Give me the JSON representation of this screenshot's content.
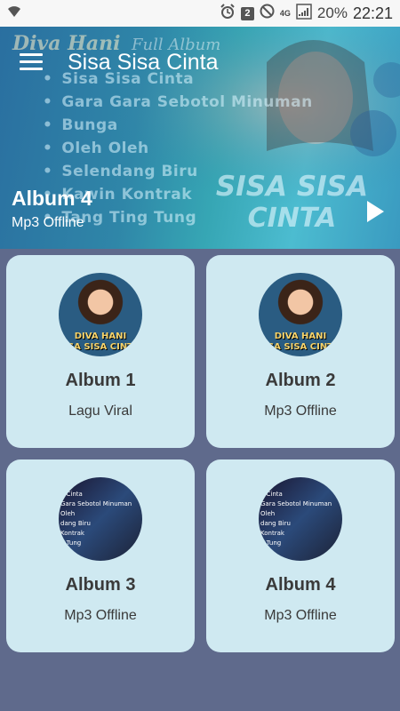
{
  "status_bar": {
    "badge": "2",
    "network": "4G",
    "battery": "20%",
    "time": "22:21"
  },
  "header": {
    "app_title": "Sisa Sisa Cinta",
    "current_album": "Album 4",
    "current_subtitle": "Mp3 Offline",
    "banner": {
      "artist": "Diva Hani",
      "full_album": "Full Album",
      "tracks": [
        "Sisa Sisa Cinta",
        "Gara Gara Sebotol Minuman",
        "Bunga",
        "Oleh Oleh",
        "Selendang Biru",
        "Kawin Kontrak",
        "Tang Ting Tung"
      ],
      "title_line1": "SISA SISA",
      "title_line2": "CINTA"
    }
  },
  "albums": [
    {
      "title": "Album 1",
      "subtitle": "Lagu Viral",
      "thumb_top": "DIVA HANI",
      "thumb_bottom": "SA SISA CINT"
    },
    {
      "title": "Album 2",
      "subtitle": "Mp3 Offline",
      "thumb_top": "DIVA HANI",
      "thumb_bottom": "SA SISA CINT"
    },
    {
      "title": "Album 3",
      "subtitle": "Mp3 Offline",
      "thumb_lines": [
        "a Cinta",
        "Gara Sebotol Minuman",
        "Oleh",
        "dang Biru",
        "Kontrak",
        "g Tung"
      ]
    },
    {
      "title": "Album 4",
      "subtitle": "Mp3 Offline",
      "thumb_lines": [
        "a Cinta",
        "Gara Sebotol Minuman",
        "Oleh",
        "dang Biru",
        "Kontrak",
        "g Tung"
      ]
    }
  ],
  "colors": {
    "background": "#5f6a8c",
    "card": "#cfe9f1",
    "status_bar": "#f7f7f7"
  }
}
